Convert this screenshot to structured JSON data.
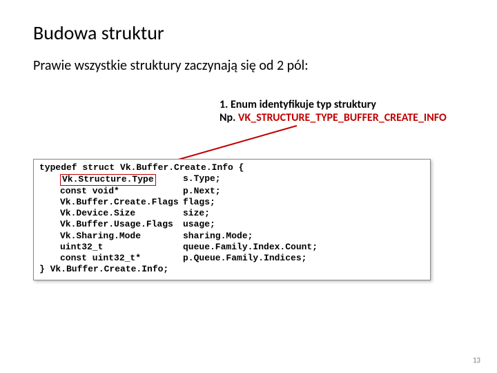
{
  "title": "Budowa struktur",
  "subtitle": "Prawie wszystkie struktury zaczynają się od 2 pól:",
  "point1_line1": "1. Enum identyfikuje typ struktury",
  "point1_np": "Np. ",
  "point1_red": "VK_STRUCTURE_TYPE_BUFFER_CREATE_INFO",
  "code": {
    "line0_a": "typedef struct ",
    "line0_b": "Vk.Buffer.Create.Info",
    "line0_c": " {",
    "rows": [
      {
        "t": "Vk.Structure.Type",
        "v": "s.Type;",
        "hl": true
      },
      {
        "t": "const void*",
        "v": "p.Next;",
        "hl": false
      },
      {
        "t": "Vk.Buffer.Create.Flags",
        "v": "flags;",
        "hl": false
      },
      {
        "t": "Vk.Device.Size",
        "v": "size;",
        "hl": false
      },
      {
        "t": "Vk.Buffer.Usage.Flags",
        "v": "usage;",
        "hl": false
      },
      {
        "t": "Vk.Sharing.Mode",
        "v": "sharing.Mode;",
        "hl": false
      },
      {
        "t": "uint32_t",
        "v": "queue.Family.Index.Count;",
        "hl": false
      },
      {
        "t": "const uint32_t*",
        "v": "p.Queue.Family.Indices;",
        "hl": false
      }
    ],
    "last": "} Vk.Buffer.Create.Info;"
  },
  "page_number": "13"
}
